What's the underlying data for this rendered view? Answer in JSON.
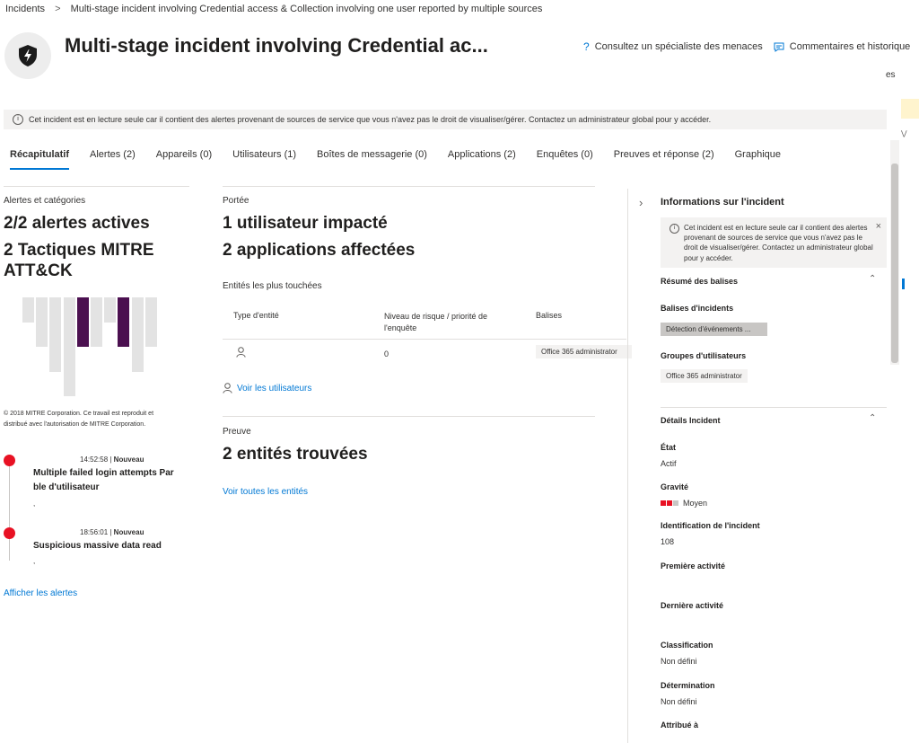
{
  "breadcrumb": {
    "root": "Incidents",
    "current": "Multi-stage incident involving Credential access & Collection involving one user reported by multiple sources"
  },
  "header": {
    "title": "Multi-stage incident involving Credential ac...",
    "actions": [
      {
        "label": "Consultez un spécialiste des menaces",
        "icon": "question-icon"
      },
      {
        "label": "Commentaires et historique",
        "icon": "comment-icon"
      }
    ],
    "edge_text": "es"
  },
  "info_bar": {
    "text": "Cet incident est en lecture seule car il contient des alertes provenant de sources de service que vous n'avez pas le droit de visualiser/gérer. Contactez un administrateur global pour y accéder."
  },
  "tabs": [
    {
      "label": "Récapitulatif",
      "active": true
    },
    {
      "label": "Alertes (2)"
    },
    {
      "label": "Appareils (0)"
    },
    {
      "label": "Utilisateurs (1)"
    },
    {
      "label": "Boîtes de messagerie (0)"
    },
    {
      "label": "Applications (2)"
    },
    {
      "label": "Enquêtes (0)"
    },
    {
      "label": "Preuves et réponse (2)"
    },
    {
      "label": "Graphique"
    }
  ],
  "alerts_panel": {
    "label": "Alertes et catégories",
    "active_alerts": "2/2 alertes actives",
    "mitre_tactics": "2 Tactiques MITRE ATT&CK",
    "mitre_chart": {
      "bars": [
        {
          "value": 1,
          "active": false
        },
        {
          "value": 2,
          "active": false
        },
        {
          "value": 3,
          "active": false
        },
        {
          "value": 4,
          "active": false
        },
        {
          "value": 2,
          "active": true
        },
        {
          "value": 2,
          "active": false
        },
        {
          "value": 1,
          "active": false
        },
        {
          "value": 2,
          "active": true
        },
        {
          "value": 3,
          "active": false
        },
        {
          "value": 2,
          "active": false
        }
      ]
    },
    "copyright_line1": "© 2018 MITRE Corporation. Ce travail est reproduit et",
    "copyright_line2": "distribué avec l'autorisation de MITRE Corporation.",
    "timeline": [
      {
        "time": "14:52:58",
        "status": "Nouveau",
        "title": "Multiple failed login attempts Par ble d'utilisateur",
        "sub": ","
      },
      {
        "time": "18:56:01",
        "status": "Nouveau",
        "title": "Suspicious massive data read",
        "sub": ","
      }
    ],
    "show_alerts_link": "Afficher les alertes"
  },
  "scope_panel": {
    "label": "Portée",
    "impacted_users": "1 utilisateur impacté",
    "affected_apps": "2 applications affectées",
    "top_entities_label": "Entités les plus touchées",
    "table": {
      "headers": [
        "Type d'entité",
        "Niveau de risque / priorité de l'enquête",
        "Balises"
      ],
      "rows": [
        {
          "risk": "0",
          "tag": "Office 365 administrator"
        }
      ]
    },
    "view_users_link": "Voir les utilisateurs"
  },
  "evidence_panel": {
    "label": "Preuve",
    "entities_found": "2 entités trouvées",
    "view_all_link": "Voir toutes les entités"
  },
  "side_panel": {
    "title": "Informations sur l'incident",
    "message": "Cet incident est en lecture seule car il contient des alertes provenant de sources de service que vous n'avez pas le droit de visualiser/gérer. Contactez un administrateur global pour y accéder.",
    "tags_summary": {
      "heading": "Résumé des balises",
      "incident_tags_label": "Balises d'incidents",
      "incident_tag": "Détection d'événements ...",
      "user_groups_label": "Groupes d'utilisateurs",
      "user_group_tag": "Office 365 administrator"
    },
    "details": {
      "heading": "Détails Incident",
      "fields": {
        "state_label": "État",
        "state_value": "Actif",
        "severity_label": "Gravité",
        "severity_value": "Moyen",
        "severity_level": 2,
        "severity_max": 3,
        "id_label": "Identification de l'incident",
        "id_value": "108",
        "first_activity_label": "Première activité",
        "last_activity_label": "Dernière activité",
        "classification_label": "Classification",
        "classification_value": "Non défini",
        "determination_label": "Détermination",
        "determination_value": "Non défini",
        "assigned_label": "Attribué à"
      }
    }
  },
  "colors": {
    "accent": "#0078d4",
    "mitre_active": "#4b1050",
    "mitre_inactive": "#e3e3e3",
    "severity": "#e81123"
  }
}
